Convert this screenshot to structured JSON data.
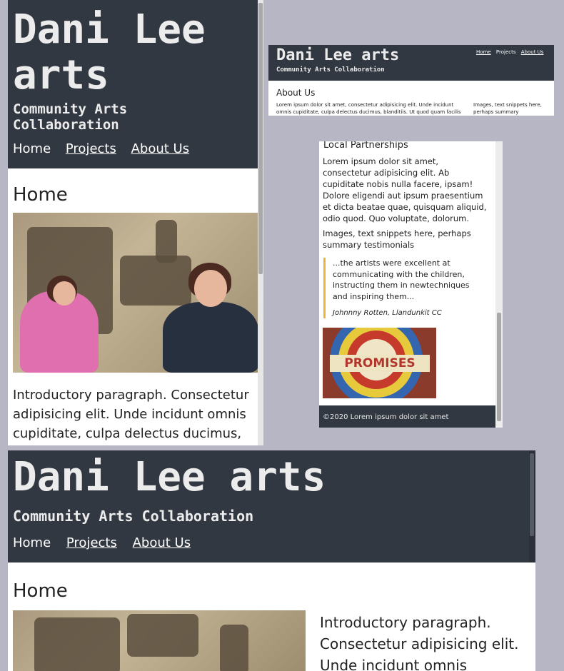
{
  "site": {
    "brand_line1": "Dani Lee",
    "brand_line2": "arts",
    "brand_full": "Dani Lee arts",
    "tagline_line1": "Community Arts",
    "tagline_line2": "Collaboration",
    "tagline_full": "Community Arts Collaboration"
  },
  "nav": {
    "home": "Home",
    "projects": "Projects",
    "about": "About Us"
  },
  "home": {
    "heading": "Home",
    "intro_mobile": "Introductory paragraph. Consectetur adipisicing elit. Unde incidunt omnis cupiditate, culpa delectus ducimus,",
    "intro_desktop": "Introductory paragraph. Consectetur adipisicing elit. Unde incidunt omnis"
  },
  "about_panel": {
    "heading": "About Us",
    "paragraph": "Lorem ipsum dolor sit amet, consectetur adipisicing elit. Unde incidunt omnis cupiditate, culpa delectus ducimus, blanditiis. Ut quod quam facilis",
    "aside": "Images, text snippets here, perhaps summary"
  },
  "partners_panel": {
    "heading": "Local Partnerships",
    "paragraph": "Lorem ipsum dolor sit amet, consectetur adipisicing elit. Ab cupiditate nobis nulla facere, ipsam! Dolore eligendi aut ipsum praesentium et dicta beatae quae, quisquam aliquid, odio quod. Quo voluptate, dolorum.",
    "snippets": "Images, text snippets here, perhaps summary testimonials",
    "quote": "...the artists were excellent at communicating with the children, instructing them in newtechniques and inspiring them...",
    "attribution": "Johnnny Rotten, Llandunkit CC",
    "mosaic_word": "PROMISES",
    "footer": "©2020 Lorem ipsum dolor sit amet"
  },
  "colors": {
    "header_bg": "#323842",
    "page_bg": "#b6b6c4",
    "quote_border": "#f0b33a"
  }
}
